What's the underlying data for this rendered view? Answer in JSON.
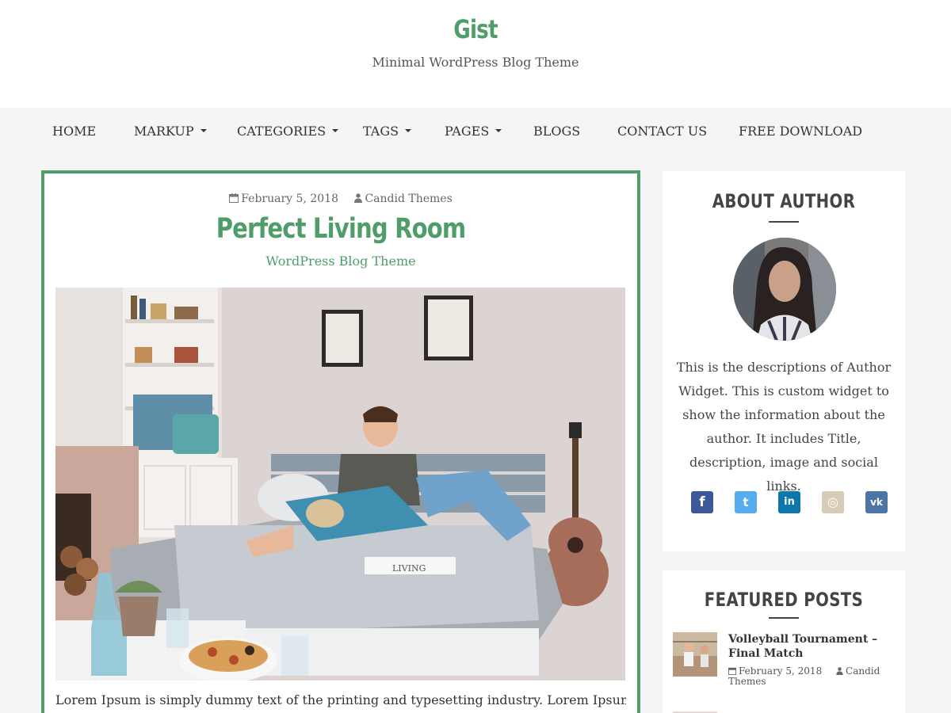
{
  "site": {
    "title": "Gist",
    "tagline": "Minimal WordPress Blog Theme",
    "accent_color": "#4f9d69"
  },
  "nav": {
    "items": [
      {
        "label": "HOME",
        "has_dropdown": false
      },
      {
        "label": "MARKUP",
        "has_dropdown": true
      },
      {
        "label": "CATEGORIES",
        "has_dropdown": true
      },
      {
        "label": "TAGS",
        "has_dropdown": true
      },
      {
        "label": "PAGES",
        "has_dropdown": true
      },
      {
        "label": "BLOGS",
        "has_dropdown": false
      },
      {
        "label": "CONTACT US",
        "has_dropdown": false
      },
      {
        "label": "FREE DOWNLOAD",
        "has_dropdown": false
      }
    ]
  },
  "post": {
    "date": "February 5, 2018",
    "author": "Candid Themes",
    "title": "Perfect Living Room",
    "subtitle": "WordPress Blog Theme",
    "image_alt": "couple on a bed in a living room with a guitar",
    "image_tray_text": "LIVING",
    "excerpt": "Lorem Ipsum is simply dummy text of the printing and typesetting industry. Lorem Ipsum has"
  },
  "about": {
    "title": "ABOUT AUTHOR",
    "description": "This is the descriptions of Author Widget. This is custom widget to show the information about the author. It includes Title, description, image and social links.",
    "social": [
      {
        "name": "facebook",
        "glyph": "f",
        "color": "#3b5998"
      },
      {
        "name": "twitter",
        "glyph": "t",
        "color": "#55acee"
      },
      {
        "name": "linkedin",
        "glyph": "in",
        "color": "#0e76a8"
      },
      {
        "name": "instagram",
        "glyph": "◎",
        "color": "#d6cbb5"
      },
      {
        "name": "vk",
        "glyph": "vk",
        "color": "#4c75a3"
      }
    ]
  },
  "featured": {
    "title": "FEATURED POSTS",
    "items": [
      {
        "title": "Volleyball Tournament – Final Match",
        "date": "February 5, 2018",
        "author": "Candid Themes"
      }
    ]
  }
}
